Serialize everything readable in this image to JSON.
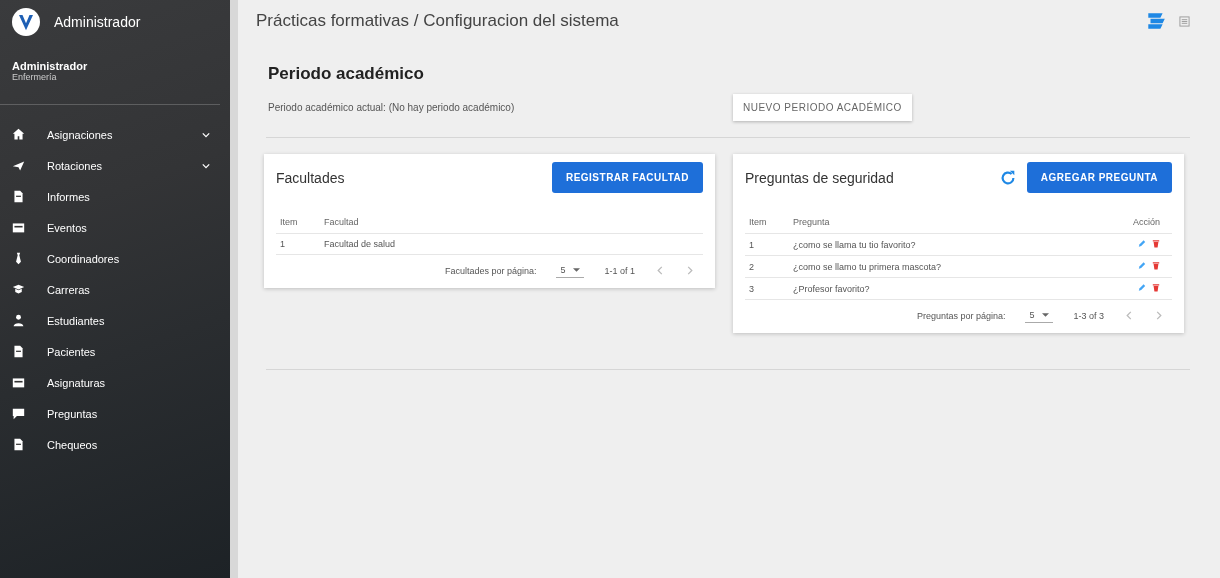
{
  "sidebar": {
    "title": "Administrador",
    "user": {
      "name": "Administrador",
      "role": "Enfermería"
    },
    "items": [
      {
        "label": "Asignaciones",
        "expandable": true
      },
      {
        "label": "Rotaciones",
        "expandable": true
      },
      {
        "label": "Informes",
        "expandable": false
      },
      {
        "label": "Eventos",
        "expandable": false
      },
      {
        "label": "Coordinadores",
        "expandable": false
      },
      {
        "label": "Carreras",
        "expandable": false
      },
      {
        "label": "Estudiantes",
        "expandable": false
      },
      {
        "label": "Pacientes",
        "expandable": false
      },
      {
        "label": "Asignaturas",
        "expandable": false
      },
      {
        "label": "Preguntas",
        "expandable": false
      },
      {
        "label": "Chequeos",
        "expandable": false
      }
    ]
  },
  "header": {
    "breadcrumb": "Prácticas formativas / Configuracion del sistema"
  },
  "period": {
    "title": "Periodo académico",
    "current": "Periodo académico actual: (No hay periodo académico)",
    "button": "NUEVO PERIODO ACADÉMICO"
  },
  "faculties": {
    "title": "Facultades",
    "button": "REGISTRAR FACULTAD",
    "columns": [
      "Item",
      "Facultad"
    ],
    "rows": [
      [
        "1",
        "Facultad de salud"
      ]
    ],
    "pagination": {
      "label": "Facultades por página:",
      "per_page": "5",
      "range": "1-1 of 1"
    }
  },
  "questions": {
    "title": "Preguntas de seguridad",
    "button": "AGREGAR PREGUNTA",
    "columns": [
      "Item",
      "Pregunta",
      "Acción"
    ],
    "rows": [
      [
        "1",
        "¿como se llama tu tio favorito?"
      ],
      [
        "2",
        "¿como se llamo tu primera mascota?"
      ],
      [
        "3",
        "¿Profesor favorito?"
      ]
    ],
    "pagination": {
      "label": "Preguntas por página:",
      "per_page": "5",
      "range": "1-3 of 3"
    }
  }
}
